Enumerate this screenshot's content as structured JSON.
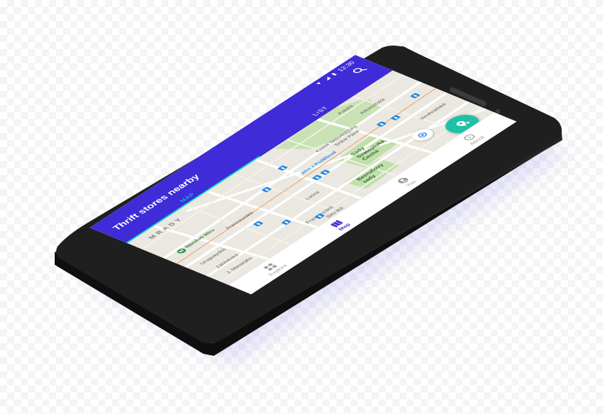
{
  "status_bar": {
    "time": "12:30"
  },
  "appbar": {
    "title": "Thrift stores nearby"
  },
  "tabs": [
    {
      "label": "MAP",
      "active": true
    },
    {
      "label": "LIST",
      "active": false
    }
  ],
  "map": {
    "district": "MRADY",
    "labels": {
      "namesti_miru": "Náměstí Míru",
      "jiho": "Jiho z Poděbrad",
      "kostel": "Kostel Nejsvětějšího",
      "srdce": "Srdce Páně",
      "sady": "Sady",
      "svatopluka": "Svatopluka",
      "cecha": "Čecha",
      "bezruc": "Bezručovy",
      "sady2": "sady",
      "francouzska": "Francouzská",
      "francouzska2": "Francouzská",
      "uruguayska": "Uruguayská",
      "zahrebska": "Záhřebská",
      "masaryka": "J. Masaryka",
      "lucna": "Lucna",
      "slezska": "Slezská",
      "krkonosska": "Krkonošská",
      "polska": "Polská",
      "vinohradska": "Vinohradská"
    }
  },
  "bottom_nav": [
    {
      "label": "Explore",
      "icon": "grid-icon",
      "active": false
    },
    {
      "label": "Map",
      "icon": "map-icon",
      "active": true
    },
    {
      "label": "You",
      "icon": "person-icon",
      "active": false
    },
    {
      "label": "About",
      "icon": "info-icon",
      "active": false
    }
  ],
  "colors": {
    "primary": "#3f2bd8",
    "accent": "#00e6d2",
    "fab": "#1fc1a6",
    "phone_body": "#1f1f1f"
  }
}
